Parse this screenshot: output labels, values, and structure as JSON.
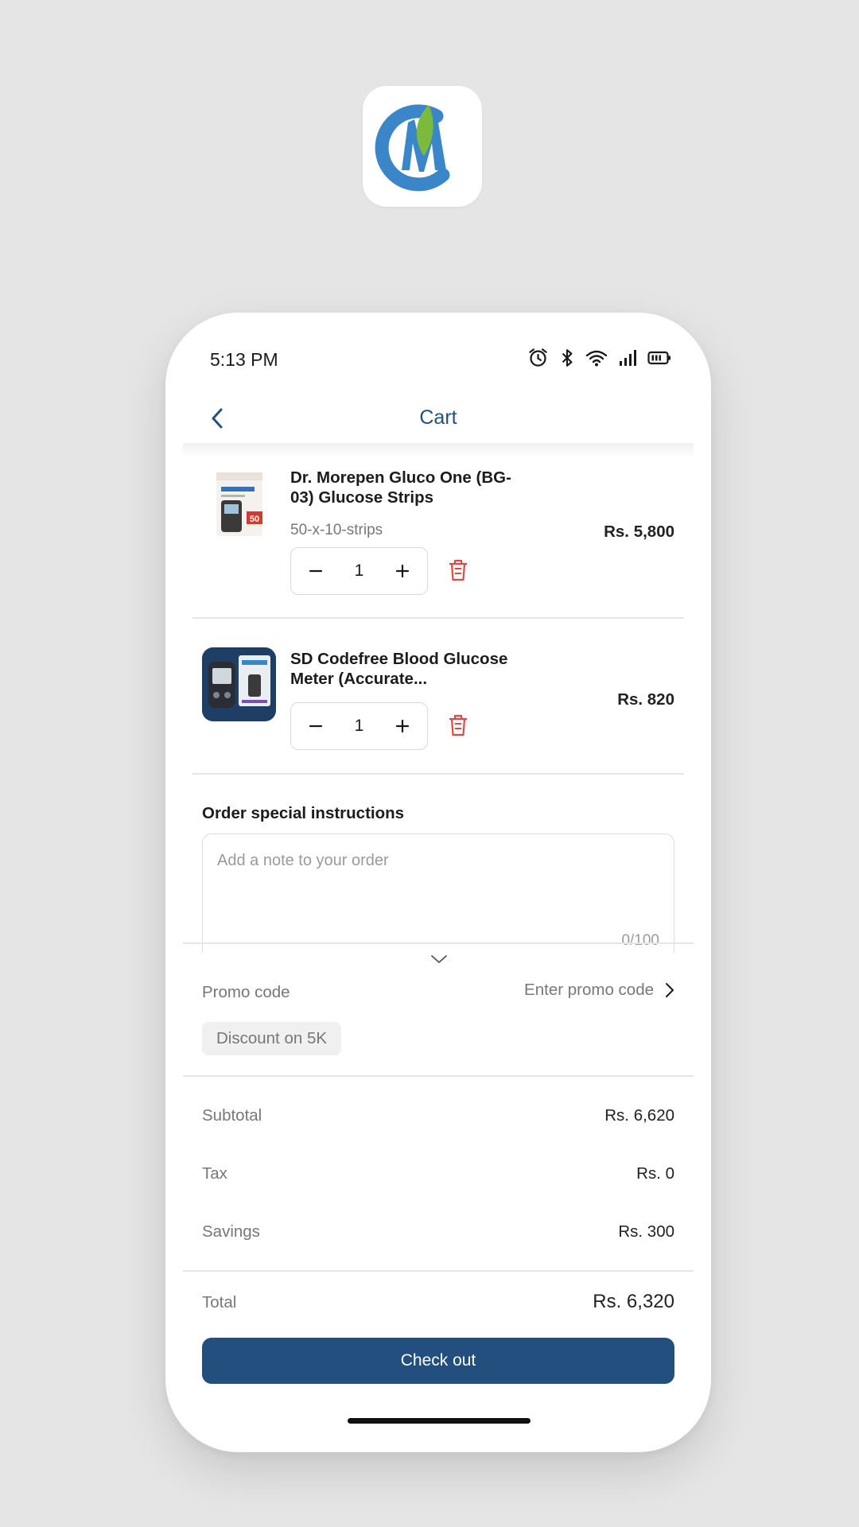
{
  "status_bar": {
    "time": "5:13 PM"
  },
  "header": {
    "title": "Cart"
  },
  "cart_items": [
    {
      "name": "Dr. Morepen Gluco One (BG-03) Glucose Strips",
      "variant": "50-x-10-strips",
      "price": "Rs. 5,800",
      "quantity": "1",
      "image_badge": "50"
    },
    {
      "name": "SD Codefree Blood Glucose Meter (Accurate...",
      "price": "Rs. 820",
      "quantity": "1"
    }
  ],
  "instructions": {
    "title": "Order special instructions",
    "placeholder": "Add a note to your order",
    "counter": "0/100"
  },
  "promo": {
    "label": "Promo code",
    "action": "Enter promo code",
    "chip": "Discount on 5K"
  },
  "summary": {
    "subtotal_label": "Subtotal",
    "subtotal_value": "Rs. 6,620",
    "tax_label": "Tax",
    "tax_value": "Rs. 0",
    "savings_label": "Savings",
    "savings_value": "Rs. 300",
    "total_label": "Total",
    "total_value": "Rs. 6,320"
  },
  "checkout": {
    "label": "Check out"
  },
  "colors": {
    "accent": "#224f7d",
    "delete": "#e04848",
    "logo_blue": "#3b86c8",
    "logo_green": "#7cba3d"
  },
  "icons": [
    "alarm-icon",
    "bluetooth-icon",
    "wifi-icon",
    "signal-icon",
    "battery-icon",
    "chevron-left-icon",
    "minus-icon",
    "plus-icon",
    "trash-icon",
    "chevron-down-icon",
    "chevron-right-icon"
  ]
}
